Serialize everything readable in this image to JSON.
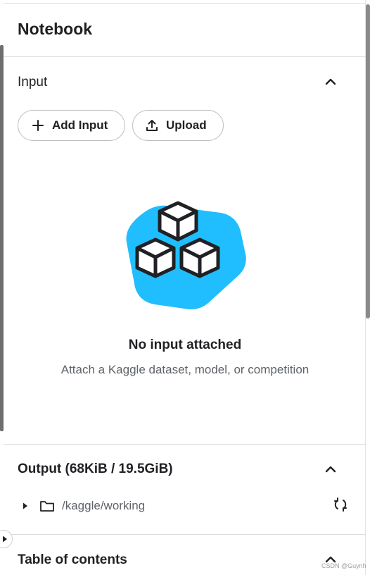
{
  "panel": {
    "title": "Notebook"
  },
  "input_section": {
    "title": "Input",
    "add_input_label": "Add Input",
    "upload_label": "Upload",
    "empty_title": "No input attached",
    "empty_subtitle": "Attach a Kaggle dataset, model, or competition",
    "collapse_icon": "chevron-up-icon"
  },
  "output_section": {
    "title": "Output (68KiB / 19.5GiB)",
    "folder_path": "/kaggle/working",
    "collapse_icon": "chevron-up-icon",
    "refresh_icon": "refresh-icon"
  },
  "toc_section": {
    "title": "Table of contents",
    "collapse_icon": "chevron-up-icon"
  },
  "watermark": "CSDN @Guynh",
  "colors": {
    "illustration_blob": "#20BEFF",
    "text_primary": "#202124",
    "text_secondary": "#5f6368",
    "divider": "#dadce0"
  }
}
